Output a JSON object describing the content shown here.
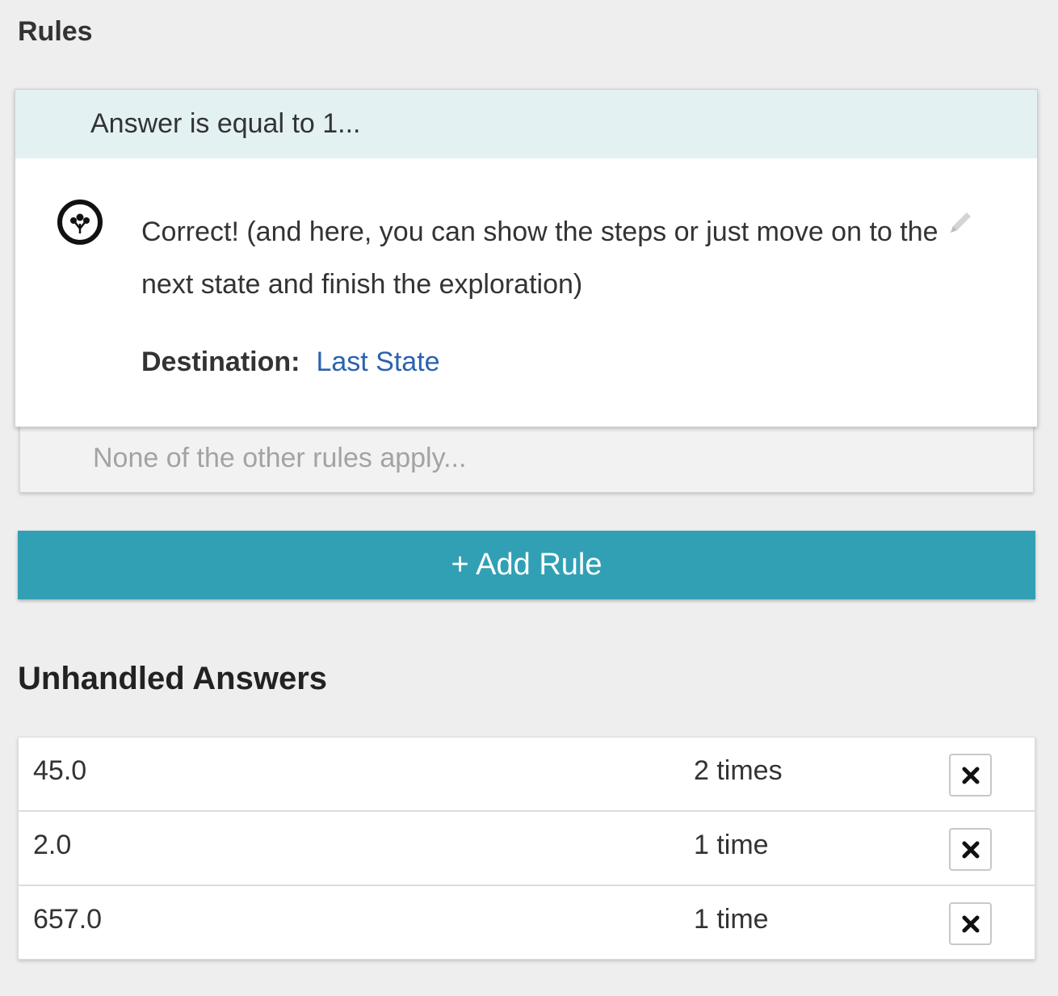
{
  "rules": {
    "title": "Rules",
    "active_rule": {
      "condition": "Answer is equal to 1...",
      "feedback": "Correct! (and here, you can show the steps or just move on to the next state and finish the exploration)",
      "destination_label": "Destination:",
      "destination_value": "Last State",
      "icon": "oppia-logo-icon",
      "edit_icon": "pencil-icon"
    },
    "default_rule": {
      "condition": "None of the other rules apply..."
    },
    "add_rule_label": "+ Add Rule"
  },
  "unhandled_answers": {
    "title": "Unhandled Answers",
    "rows": [
      {
        "answer": "45.0",
        "count": "2 times",
        "delete_icon": "close-icon"
      },
      {
        "answer": "2.0",
        "count": "1 time",
        "delete_icon": "close-icon"
      },
      {
        "answer": "657.0",
        "count": "1 time",
        "delete_icon": "close-icon"
      }
    ]
  },
  "colors": {
    "background": "#eeeeee",
    "rule_header": "#e3f1f3",
    "accent_button": "#31a0b5",
    "link": "#2b62b0",
    "muted_text": "#a3a3a3"
  }
}
